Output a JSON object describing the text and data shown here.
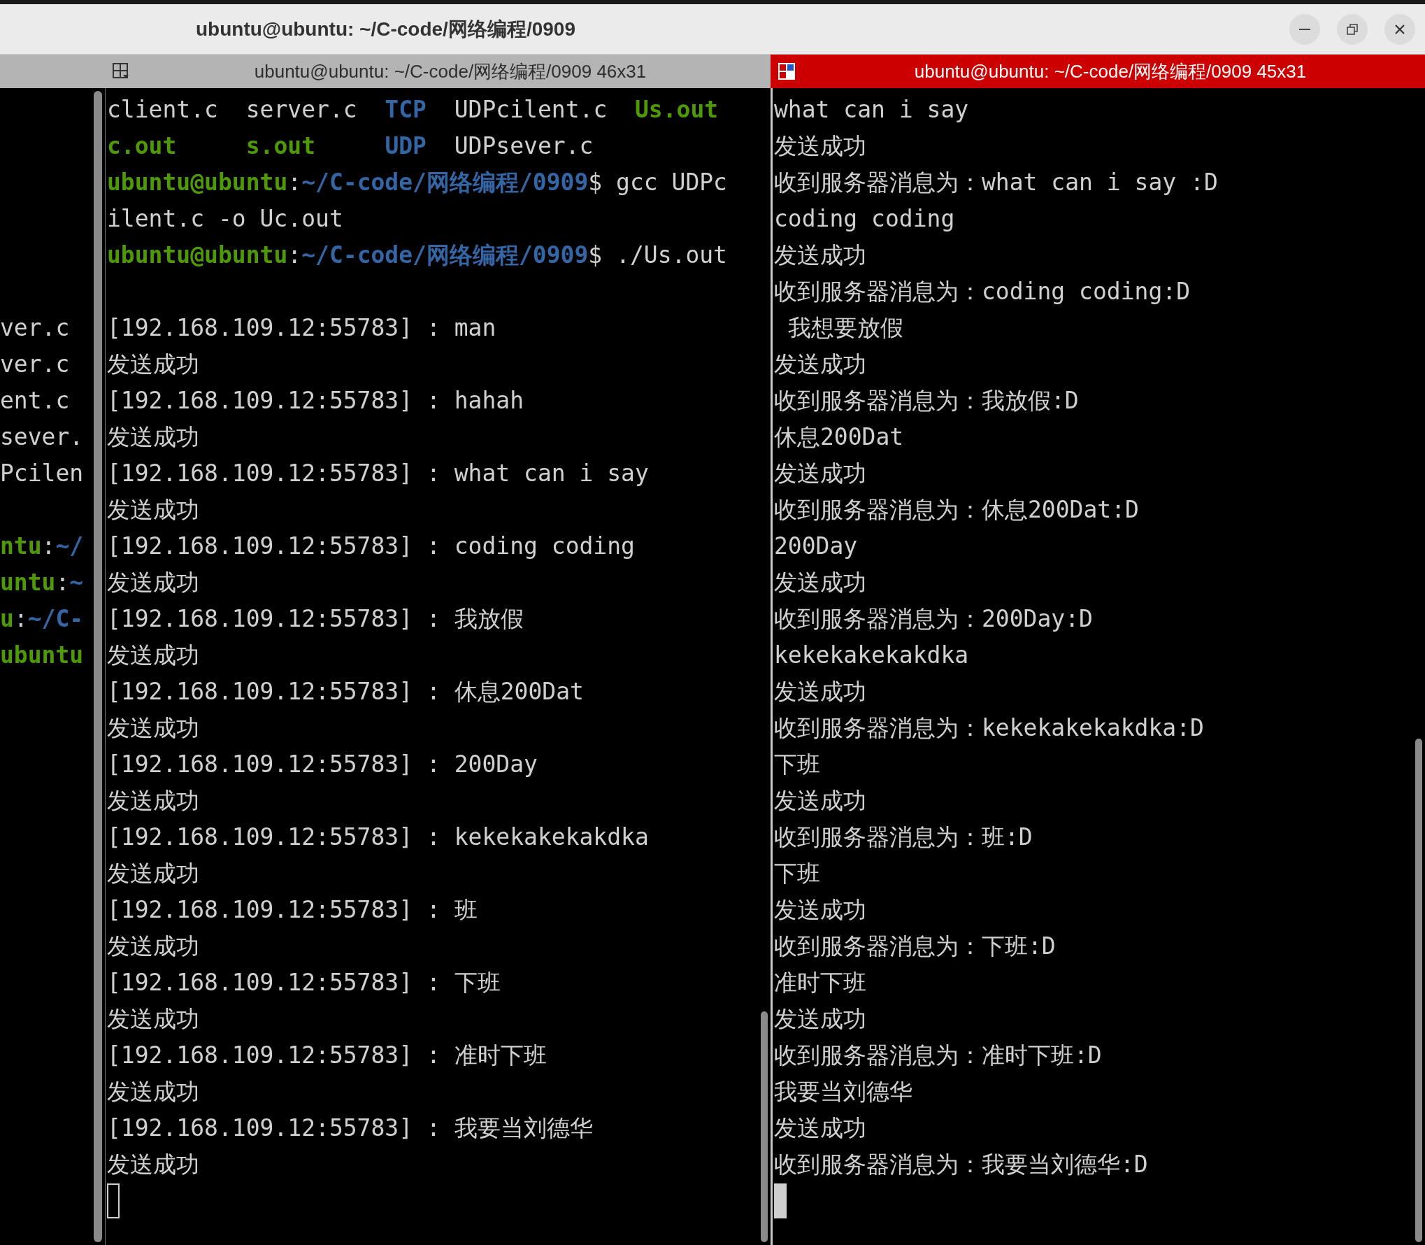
{
  "window": {
    "title": "ubuntu@ubuntu: ~/C-code/网络编程/0909"
  },
  "panes": [
    {
      "kind": "partial",
      "lines": [
        {
          "kind": "blank"
        },
        {
          "kind": "blank"
        },
        {
          "kind": "blank"
        },
        {
          "kind": "blank"
        },
        {
          "kind": "blank"
        },
        {
          "kind": "blank"
        },
        {
          "kind": "text",
          "segments": [
            {
              "text": "ver.c",
              "kind": "plain"
            }
          ]
        },
        {
          "kind": "text",
          "segments": [
            {
              "text": "ver.c",
              "kind": "plain"
            }
          ]
        },
        {
          "kind": "text",
          "segments": [
            {
              "text": "ent.c",
              "kind": "plain"
            }
          ]
        },
        {
          "kind": "text",
          "segments": [
            {
              "text": "sever.",
              "kind": "plain"
            }
          ]
        },
        {
          "kind": "text",
          "segments": [
            {
              "text": "Pcilen",
              "kind": "plain"
            }
          ]
        },
        {
          "kind": "blank"
        },
        {
          "kind": "text",
          "segments": [
            {
              "text": "ntu",
              "kind": "user"
            },
            {
              "text": ":",
              "kind": "plain"
            },
            {
              "text": "~/",
              "kind": "path"
            }
          ]
        },
        {
          "kind": "text",
          "segments": [
            {
              "text": "untu",
              "kind": "user"
            },
            {
              "text": ":",
              "kind": "plain"
            },
            {
              "text": "~",
              "kind": "path"
            }
          ]
        },
        {
          "kind": "text",
          "segments": [
            {
              "text": "u",
              "kind": "user"
            },
            {
              "text": ":",
              "kind": "plain"
            },
            {
              "text": "~/C-",
              "kind": "path"
            }
          ]
        },
        {
          "kind": "text",
          "segments": [
            {
              "text": "ubuntu",
              "kind": "user"
            }
          ]
        }
      ]
    },
    {
      "kind": "terminal",
      "title": "ubuntu@ubuntu: ~/C-code/网络编程/0909 46x31",
      "active": false,
      "lines": [
        {
          "kind": "text",
          "segments": [
            {
              "text": "client.c  server.c  ",
              "kind": "plain"
            },
            {
              "text": "TCP",
              "kind": "directory"
            },
            {
              "text": "  UDPcilent.c  ",
              "kind": "plain"
            },
            {
              "text": "Us.out",
              "kind": "executable"
            }
          ]
        },
        {
          "kind": "text",
          "segments": [
            {
              "text": "c.out     ",
              "kind": "executable"
            },
            {
              "text": "s.out     ",
              "kind": "executable"
            },
            {
              "text": "UDP",
              "kind": "directory"
            },
            {
              "text": "  UDPsever.c",
              "kind": "plain"
            }
          ]
        },
        {
          "kind": "text",
          "segments": [
            {
              "text": "ubuntu@ubuntu",
              "kind": "user"
            },
            {
              "text": ":",
              "kind": "plain"
            },
            {
              "text": "~/C-code/网络编程/0909",
              "kind": "path"
            },
            {
              "text": "$ gcc UDPc",
              "kind": "plain"
            }
          ]
        },
        {
          "kind": "text",
          "segments": [
            {
              "text": "ilent.c -o Uc.out",
              "kind": "plain"
            }
          ]
        },
        {
          "kind": "text",
          "segments": [
            {
              "text": "ubuntu@ubuntu",
              "kind": "user"
            },
            {
              "text": ":",
              "kind": "plain"
            },
            {
              "text": "~/C-code/网络编程/0909",
              "kind": "path"
            },
            {
              "text": "$ ./Us.out",
              "kind": "plain"
            }
          ]
        },
        {
          "kind": "blank"
        },
        {
          "kind": "text",
          "segments": [
            {
              "text": "[192.168.109.12:55783] : man",
              "kind": "plain"
            }
          ]
        },
        {
          "kind": "text",
          "segments": [
            {
              "text": "发送成功",
              "kind": "plain"
            }
          ]
        },
        {
          "kind": "text",
          "segments": [
            {
              "text": "[192.168.109.12:55783] : hahah",
              "kind": "plain"
            }
          ]
        },
        {
          "kind": "text",
          "segments": [
            {
              "text": "发送成功",
              "kind": "plain"
            }
          ]
        },
        {
          "kind": "text",
          "segments": [
            {
              "text": "[192.168.109.12:55783] : what can i say",
              "kind": "plain"
            }
          ]
        },
        {
          "kind": "text",
          "segments": [
            {
              "text": "发送成功",
              "kind": "plain"
            }
          ]
        },
        {
          "kind": "text",
          "segments": [
            {
              "text": "[192.168.109.12:55783] : coding coding",
              "kind": "plain"
            }
          ]
        },
        {
          "kind": "text",
          "segments": [
            {
              "text": "发送成功",
              "kind": "plain"
            }
          ]
        },
        {
          "kind": "text",
          "segments": [
            {
              "text": "[192.168.109.12:55783] : 我放假",
              "kind": "plain"
            }
          ]
        },
        {
          "kind": "text",
          "segments": [
            {
              "text": "发送成功",
              "kind": "plain"
            }
          ]
        },
        {
          "kind": "text",
          "segments": [
            {
              "text": "[192.168.109.12:55783] : 休息200Dat",
              "kind": "plain"
            }
          ]
        },
        {
          "kind": "text",
          "segments": [
            {
              "text": "发送成功",
              "kind": "plain"
            }
          ]
        },
        {
          "kind": "text",
          "segments": [
            {
              "text": "[192.168.109.12:55783] : 200Day",
              "kind": "plain"
            }
          ]
        },
        {
          "kind": "text",
          "segments": [
            {
              "text": "发送成功",
              "kind": "plain"
            }
          ]
        },
        {
          "kind": "text",
          "segments": [
            {
              "text": "[192.168.109.12:55783] : kekekakekakdka",
              "kind": "plain"
            }
          ]
        },
        {
          "kind": "text",
          "segments": [
            {
              "text": "发送成功",
              "kind": "plain"
            }
          ]
        },
        {
          "kind": "text",
          "segments": [
            {
              "text": "[192.168.109.12:55783] : 班",
              "kind": "plain"
            }
          ]
        },
        {
          "kind": "text",
          "segments": [
            {
              "text": "发送成功",
              "kind": "plain"
            }
          ]
        },
        {
          "kind": "text",
          "segments": [
            {
              "text": "[192.168.109.12:55783] : 下班",
              "kind": "plain"
            }
          ]
        },
        {
          "kind": "text",
          "segments": [
            {
              "text": "发送成功",
              "kind": "plain"
            }
          ]
        },
        {
          "kind": "text",
          "segments": [
            {
              "text": "[192.168.109.12:55783] : 准时下班",
              "kind": "plain"
            }
          ]
        },
        {
          "kind": "text",
          "segments": [
            {
              "text": "发送成功",
              "kind": "plain"
            }
          ]
        },
        {
          "kind": "text",
          "segments": [
            {
              "text": "[192.168.109.12:55783] : 我要当刘德华",
              "kind": "plain"
            }
          ]
        },
        {
          "kind": "text",
          "segments": [
            {
              "text": "发送成功",
              "kind": "plain"
            }
          ]
        }
      ]
    },
    {
      "kind": "terminal",
      "title": "ubuntu@ubuntu: ~/C-code/网络编程/0909 45x31",
      "active": true,
      "lines": [
        {
          "kind": "text",
          "segments": [
            {
              "text": "what can i say",
              "kind": "plain"
            }
          ]
        },
        {
          "kind": "text",
          "segments": [
            {
              "text": "发送成功",
              "kind": "plain"
            }
          ]
        },
        {
          "kind": "text",
          "segments": [
            {
              "text": "收到服务器消息为：what can i say :D",
              "kind": "plain"
            }
          ]
        },
        {
          "kind": "text",
          "segments": [
            {
              "text": "coding coding",
              "kind": "plain"
            }
          ]
        },
        {
          "kind": "text",
          "segments": [
            {
              "text": "发送成功",
              "kind": "plain"
            }
          ]
        },
        {
          "kind": "text",
          "segments": [
            {
              "text": "收到服务器消息为：coding coding:D",
              "kind": "plain"
            }
          ]
        },
        {
          "kind": "text",
          "segments": [
            {
              "text": " 我想要放假",
              "kind": "plain"
            }
          ]
        },
        {
          "kind": "text",
          "segments": [
            {
              "text": "发送成功",
              "kind": "plain"
            }
          ]
        },
        {
          "kind": "text",
          "segments": [
            {
              "text": "收到服务器消息为：我放假:D",
              "kind": "plain"
            }
          ]
        },
        {
          "kind": "text",
          "segments": [
            {
              "text": "休息200Dat",
              "kind": "plain"
            }
          ]
        },
        {
          "kind": "text",
          "segments": [
            {
              "text": "发送成功",
              "kind": "plain"
            }
          ]
        },
        {
          "kind": "text",
          "segments": [
            {
              "text": "收到服务器消息为：休息200Dat:D",
              "kind": "plain"
            }
          ]
        },
        {
          "kind": "text",
          "segments": [
            {
              "text": "200Day",
              "kind": "plain"
            }
          ]
        },
        {
          "kind": "text",
          "segments": [
            {
              "text": "发送成功",
              "kind": "plain"
            }
          ]
        },
        {
          "kind": "text",
          "segments": [
            {
              "text": "收到服务器消息为：200Day:D",
              "kind": "plain"
            }
          ]
        },
        {
          "kind": "text",
          "segments": [
            {
              "text": "kekekakekakdka",
              "kind": "plain"
            }
          ]
        },
        {
          "kind": "text",
          "segments": [
            {
              "text": "发送成功",
              "kind": "plain"
            }
          ]
        },
        {
          "kind": "text",
          "segments": [
            {
              "text": "收到服务器消息为：kekekakekakdka:D",
              "kind": "plain"
            }
          ]
        },
        {
          "kind": "text",
          "segments": [
            {
              "text": "下班",
              "kind": "plain"
            }
          ]
        },
        {
          "kind": "text",
          "segments": [
            {
              "text": "发送成功",
              "kind": "plain"
            }
          ]
        },
        {
          "kind": "text",
          "segments": [
            {
              "text": "收到服务器消息为：班:D",
              "kind": "plain"
            }
          ]
        },
        {
          "kind": "text",
          "segments": [
            {
              "text": "下班",
              "kind": "plain"
            }
          ]
        },
        {
          "kind": "text",
          "segments": [
            {
              "text": "发送成功",
              "kind": "plain"
            }
          ]
        },
        {
          "kind": "text",
          "segments": [
            {
              "text": "收到服务器消息为：下班:D",
              "kind": "plain"
            }
          ]
        },
        {
          "kind": "text",
          "segments": [
            {
              "text": "准时下班",
              "kind": "plain"
            }
          ]
        },
        {
          "kind": "text",
          "segments": [
            {
              "text": "发送成功",
              "kind": "plain"
            }
          ]
        },
        {
          "kind": "text",
          "segments": [
            {
              "text": "收到服务器消息为：准时下班:D",
              "kind": "plain"
            }
          ]
        },
        {
          "kind": "text",
          "segments": [
            {
              "text": "我要当刘德华",
              "kind": "plain"
            }
          ]
        },
        {
          "kind": "text",
          "segments": [
            {
              "text": "发送成功",
              "kind": "plain"
            }
          ]
        },
        {
          "kind": "text",
          "segments": [
            {
              "text": "收到服务器消息为：我要当刘德华:D",
              "kind": "plain"
            }
          ]
        }
      ]
    }
  ]
}
